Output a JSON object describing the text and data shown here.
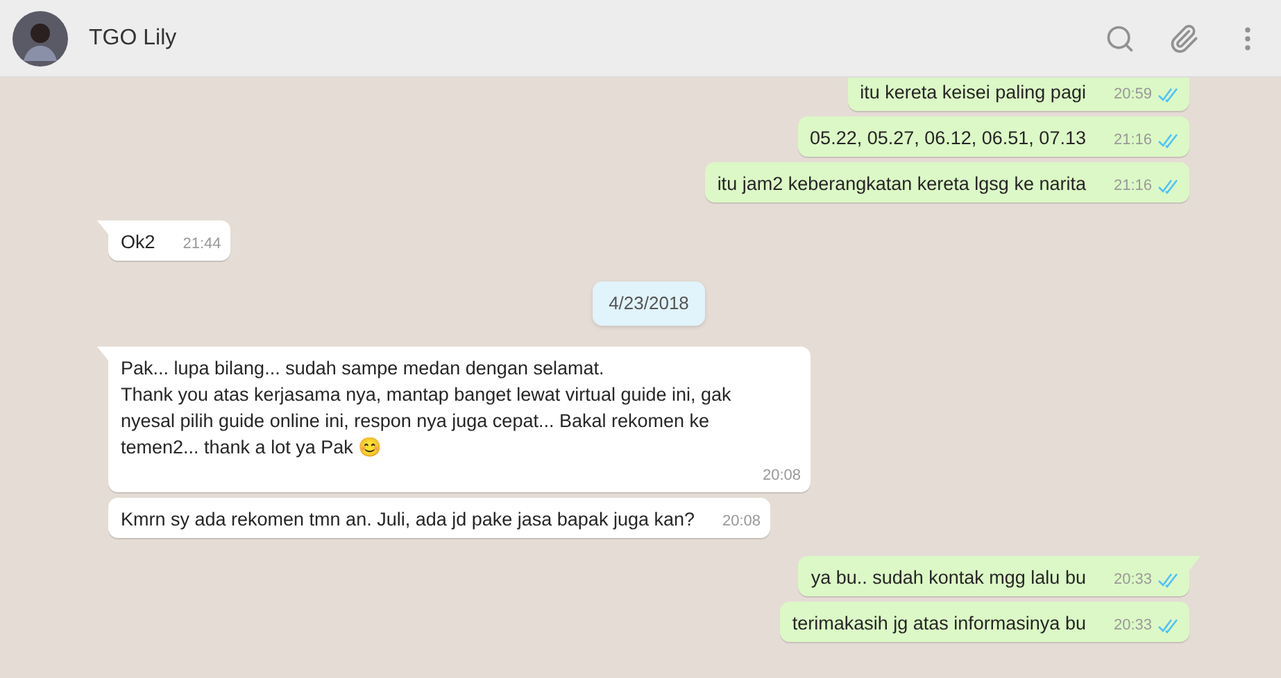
{
  "header": {
    "name": "TGO Lily"
  },
  "messages": [
    {
      "kind": "out",
      "text": "itu kereta keisei paling pagi",
      "time": "20:59",
      "tail": false,
      "read": true
    },
    {
      "kind": "out",
      "text": "05.22, 05.27, 06.12, 06.51, 07.13",
      "time": "21:16",
      "tail": false,
      "read": true
    },
    {
      "kind": "out",
      "text": "itu jam2 keberangkatan kereta lgsg ke narita",
      "time": "21:16",
      "tail": false,
      "read": true
    },
    {
      "kind": "in",
      "text": "Ok2",
      "time": "21:44",
      "tail": true
    },
    {
      "kind": "date",
      "text": "4/23/2018"
    },
    {
      "kind": "in",
      "text": "Pak... lupa bilang... sudah sampe medan dengan selamat.\nThank you atas kerjasama nya, mantap banget lewat virtual guide ini, gak nyesal pilih guide online ini, respon nya juga cepat... Bakal rekomen ke temen2... thank a lot ya Pak 😊",
      "time": "20:08",
      "tail": true
    },
    {
      "kind": "in",
      "text": "Kmrn sy ada rekomen tmn an. Juli, ada jd pake jasa bapak juga kan?",
      "time": "20:08",
      "tail": false
    },
    {
      "kind": "out",
      "text": "ya bu.. sudah kontak mgg lalu bu",
      "time": "20:33",
      "tail": true,
      "read": true
    },
    {
      "kind": "out",
      "text": "terimakasih jg atas informasinya bu",
      "time": "20:33",
      "tail": false,
      "read": true
    }
  ]
}
